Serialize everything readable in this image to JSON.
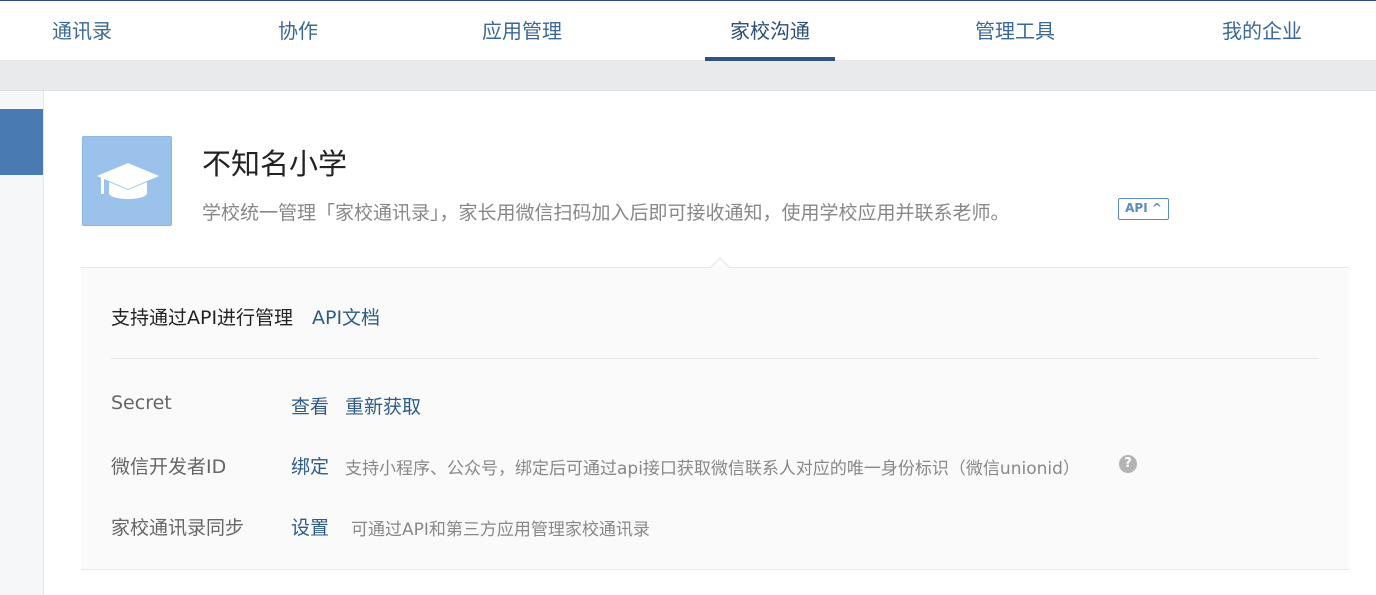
{
  "nav": {
    "tabs": [
      {
        "label": "通讯录",
        "active": false
      },
      {
        "label": "协作",
        "active": false
      },
      {
        "label": "应用管理",
        "active": false
      },
      {
        "label": "家校沟通",
        "active": true
      },
      {
        "label": "管理工具",
        "active": false
      },
      {
        "label": "我的企业",
        "active": false
      }
    ]
  },
  "app": {
    "icon": "graduation-cap-icon",
    "name": "不知名小学",
    "description": "学校统一管理「家校通讯录」，家长用微信扫码加入后即可接收通知，使用学校应用并联系老师。",
    "api_badge": "API ^"
  },
  "api_panel": {
    "support_text": "支持通过API进行管理",
    "doc_link": "API文档",
    "rows": [
      {
        "label": "Secret",
        "links": [
          "查看",
          "重新获取"
        ],
        "description": ""
      },
      {
        "label": "微信开发者ID",
        "links": [
          "绑定"
        ],
        "description": "支持小程序、公众号，绑定后可通过api接口获取微信联系人对应的唯一身份标识（微信unionid）",
        "help_icon": "?"
      },
      {
        "label": "家校通讯录同步",
        "links": [
          "设置"
        ],
        "description": "可通过API和第三方应用管理家校通讯录"
      }
    ]
  },
  "colors": {
    "accent": "#2f5383",
    "link": "#2e5c8a",
    "icon_bg": "#9bc2ea"
  }
}
